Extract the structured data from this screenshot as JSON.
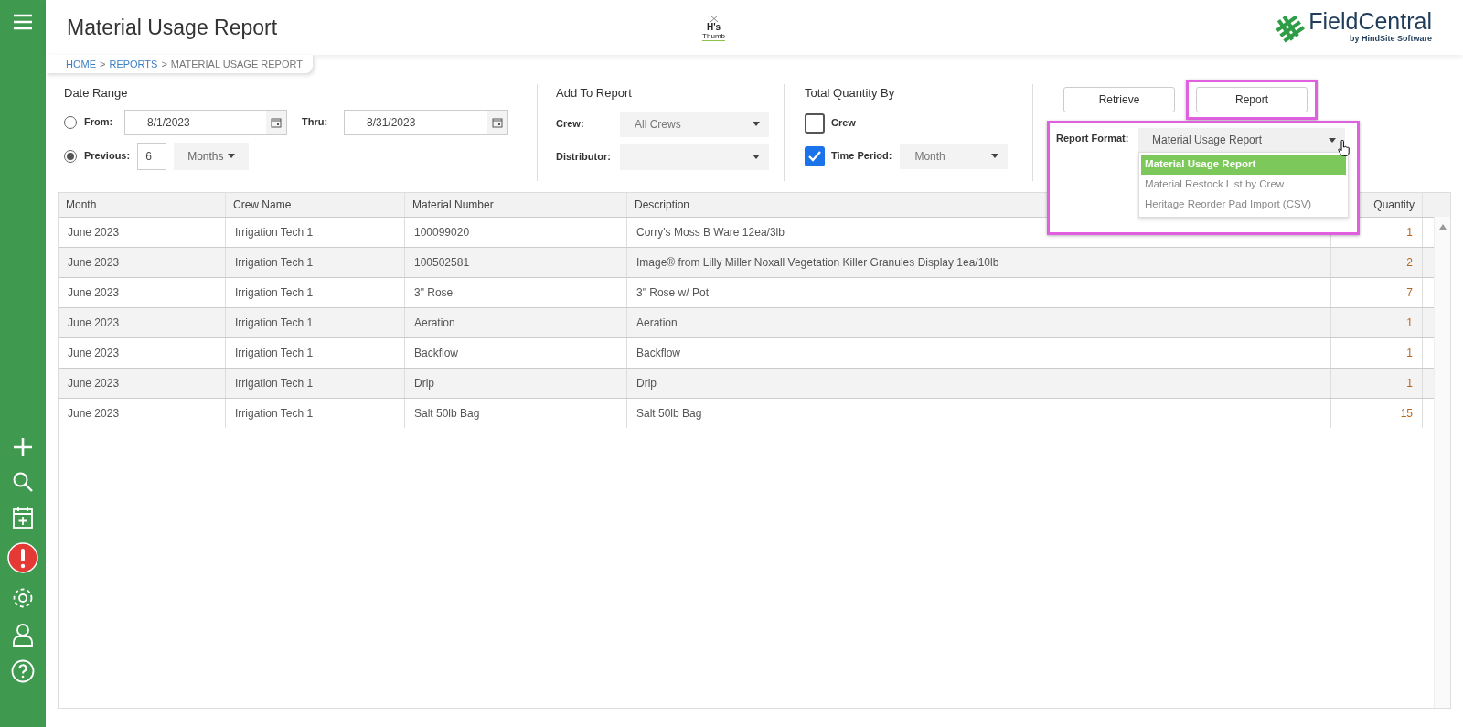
{
  "header": {
    "title": "Material Usage Report",
    "center_logo": {
      "line_1": "H's",
      "line_2": "Thumb"
    },
    "brand_logo": {
      "name": "FieldCentral",
      "tagline": "by HindSite Software"
    }
  },
  "breadcrumb": [
    {
      "label": "HOME",
      "link": true
    },
    {
      "label": "REPORTS",
      "link": true
    },
    {
      "label": "MATERIAL USAGE REPORT",
      "link": false
    }
  ],
  "breadcrumb_separator": ">",
  "date_range": {
    "title": "Date Range",
    "from": {
      "label": "From:",
      "selected": false,
      "value": "8/1/2023"
    },
    "thru": {
      "label": "Thru:",
      "value": "8/31/2023"
    },
    "previous": {
      "label": "Previous:",
      "selected": true,
      "count": "6",
      "unit": "Months"
    }
  },
  "add_to_report": {
    "title": "Add To Report",
    "fields": [
      {
        "label": "Crew:",
        "value": "All Crews"
      },
      {
        "label": "Distributor:"
      }
    ]
  },
  "total_quantity_by": {
    "title": "Total Quantity By",
    "options": [
      {
        "label": "Crew",
        "checked": false
      },
      {
        "label": "Time Period:",
        "checked": true,
        "value": "Month"
      }
    ]
  },
  "buttons": [
    {
      "label": "Retrieve",
      "highlighted": false
    },
    {
      "label": "Report",
      "highlighted": true
    }
  ],
  "report_format": {
    "label": "Report Format:",
    "value": "Material Usage Report",
    "expanded": true,
    "highlighted": true,
    "options": [
      {
        "label": "Material Usage Report",
        "selected": true
      },
      {
        "label": "Material Restock List by Crew",
        "selected": false
      },
      {
        "label": "Heritage Reorder Pad Import (CSV)",
        "selected": false
      }
    ]
  },
  "table": {
    "columns": [
      "Month",
      "Crew Name",
      "Material Number",
      "Description",
      "Quantity"
    ],
    "rows": [
      [
        "June 2023",
        "Irrigation Tech 1",
        "100099020",
        "Corry's Moss B Ware 12ea/3lb",
        "1"
      ],
      [
        "June 2023",
        "Irrigation Tech 1",
        "100502581",
        "Image® from Lilly Miller Noxall Vegetation Killer Granules Display 1ea/10lb",
        "2"
      ],
      [
        "June 2023",
        "Irrigation Tech 1",
        "3\" Rose",
        "3\" Rose w/ Pot",
        "7"
      ],
      [
        "June 2023",
        "Irrigation Tech 1",
        "Aeration",
        "Aeration",
        "1"
      ],
      [
        "June 2023",
        "Irrigation Tech 1",
        "Backflow",
        "Backflow",
        "1"
      ],
      [
        "June 2023",
        "Irrigation Tech 1",
        "Drip",
        "Drip",
        "1"
      ],
      [
        "June 2023",
        "Irrigation Tech 1",
        "Salt 50lb Bag",
        "Salt 50lb Bag",
        "15"
      ]
    ]
  },
  "sidebar": {
    "alert": true
  }
}
